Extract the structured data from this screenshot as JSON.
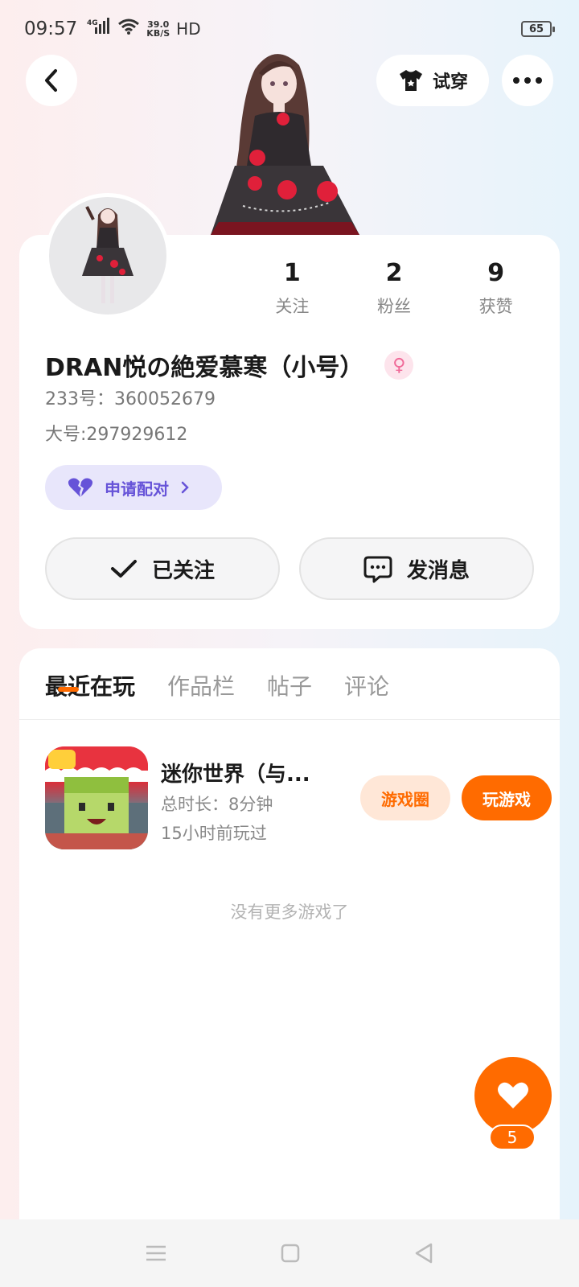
{
  "status_bar": {
    "time": "09:57",
    "network": "4G",
    "speed_value": "39.0",
    "speed_unit": "KB/S",
    "hd": "HD",
    "battery": "65"
  },
  "header": {
    "try_on_label": "试穿"
  },
  "profile": {
    "stats": [
      {
        "value": "1",
        "label": "关注"
      },
      {
        "value": "2",
        "label": "粉丝"
      },
      {
        "value": "9",
        "label": "获赞"
      }
    ],
    "username": "DRAN悦の絶爱慕寒（小号）",
    "id_text": "233号：360052679",
    "main_account": "大号:297929612",
    "pair_label": "申请配对",
    "follow_label": "已关注",
    "message_label": "发消息"
  },
  "tabs": [
    {
      "label": "最近在玩"
    },
    {
      "label": "作品栏"
    },
    {
      "label": "帖子"
    },
    {
      "label": "评论"
    }
  ],
  "games": [
    {
      "title": "迷你世界（与...",
      "playtime": "总时长：8分钟",
      "last_played": "15小时前玩过",
      "circle_label": "游戏圈",
      "play_label": "玩游戏"
    }
  ],
  "no_more_text": "没有更多游戏了",
  "like": {
    "count": "5"
  },
  "colors": {
    "accent": "#ff6b00",
    "pair_purple": "#6653d8",
    "gender_pink": "#f06a98"
  }
}
